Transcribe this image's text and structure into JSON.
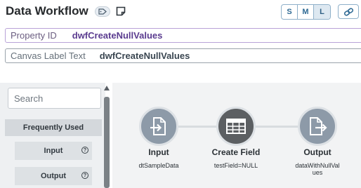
{
  "header": {
    "title": "Data Workflow",
    "size_options": [
      "S",
      "M",
      "L"
    ],
    "selected_size": "L"
  },
  "fields": {
    "property_id": {
      "label": "Property ID",
      "value": "dwfCreateNullValues"
    },
    "canvas_label": {
      "label": "Canvas Label Text",
      "value": "dwfCreateNullValues"
    }
  },
  "toolbox": {
    "search_placeholder": "Search",
    "section_title": "Frequently Used",
    "items": [
      {
        "label": "Input"
      },
      {
        "label": "Output"
      }
    ]
  },
  "workflow": {
    "nodes": [
      {
        "title": "Input",
        "subtitle": "dtSampleData"
      },
      {
        "title": "Create Field",
        "subtitle": "testField=NULL"
      },
      {
        "title": "Output",
        "subtitle": "dataWithNullVal",
        "subtitle2": "ues"
      }
    ]
  },
  "colors": {
    "accent": "#2f6a94",
    "property_border": "#b9a2d8",
    "property_value": "#5a3b8f",
    "io_node": "#8d9aa8",
    "create_node": "#5c5f62"
  },
  "icons": {
    "tag": "tag-icon",
    "note": "note-icon",
    "link": "link-icon",
    "input_node": "import-document-icon",
    "create_node": "table-icon",
    "output_node": "export-document-icon"
  }
}
